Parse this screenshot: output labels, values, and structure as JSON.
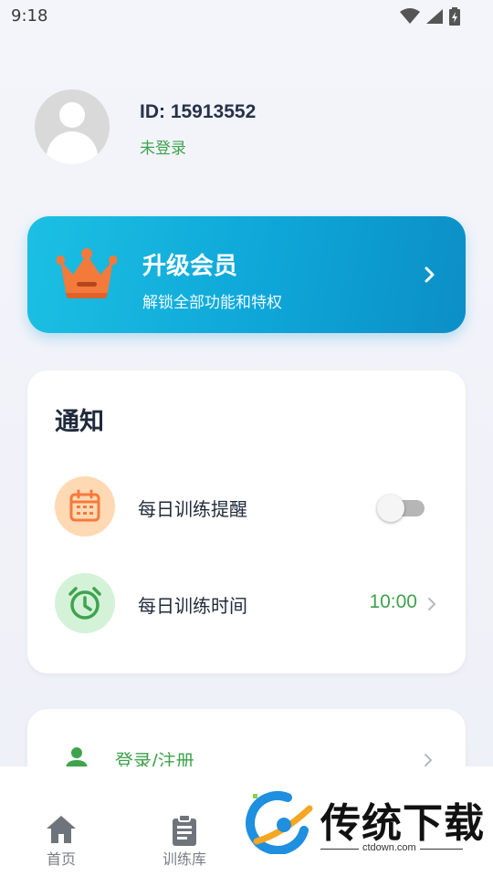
{
  "status_bar": {
    "time": "9:18",
    "icons": [
      "wifi-icon",
      "signal-icon",
      "battery-charging-icon"
    ]
  },
  "profile": {
    "id_text": "ID: 15913552",
    "login_status": "未登录"
  },
  "vip": {
    "title": "升级会员",
    "subtitle": "解锁全部功能和特权",
    "icon": "crown-icon"
  },
  "notifications": {
    "title": "通知",
    "daily_reminder": {
      "label": "每日训练提醒",
      "enabled": false,
      "icon": "calendar-icon"
    },
    "daily_time": {
      "label": "每日训练时间",
      "value": "10:00",
      "icon": "alarm-clock-icon"
    }
  },
  "account": {
    "login_label": "登录/注册",
    "icon": "user-icon"
  },
  "bottom_nav": {
    "items": [
      {
        "label": "首页",
        "icon": "home-icon"
      },
      {
        "label": "训练库",
        "icon": "clipboard-icon"
      }
    ]
  },
  "watermark": {
    "text": "传统下载",
    "url": "ctdown.com"
  },
  "colors": {
    "accent_green": "#3fa34d",
    "vip_gradient_start": "#1cc0e3",
    "vip_gradient_end": "#0b8fc6",
    "calendar_bg": "#ffd9b3",
    "clock_bg": "#d4f2d8"
  }
}
